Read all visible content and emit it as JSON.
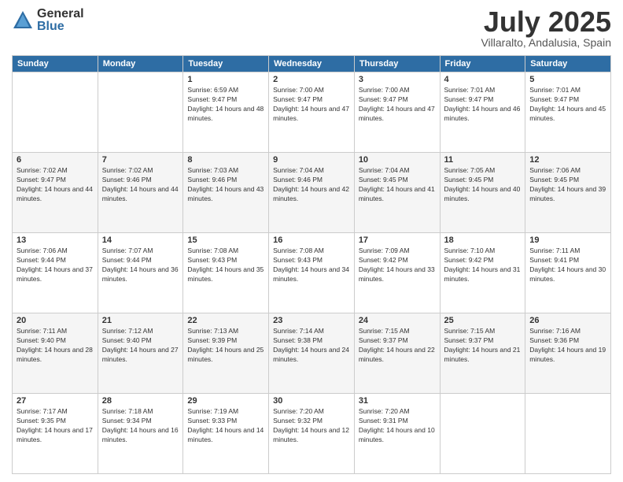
{
  "logo": {
    "general": "General",
    "blue": "Blue"
  },
  "title": "July 2025",
  "subtitle": "Villaralto, Andalusia, Spain",
  "days_header": [
    "Sunday",
    "Monday",
    "Tuesday",
    "Wednesday",
    "Thursday",
    "Friday",
    "Saturday"
  ],
  "weeks": [
    [
      {
        "day": "",
        "sunrise": "",
        "sunset": "",
        "daylight": ""
      },
      {
        "day": "",
        "sunrise": "",
        "sunset": "",
        "daylight": ""
      },
      {
        "day": "1",
        "sunrise": "Sunrise: 6:59 AM",
        "sunset": "Sunset: 9:47 PM",
        "daylight": "Daylight: 14 hours and 48 minutes."
      },
      {
        "day": "2",
        "sunrise": "Sunrise: 7:00 AM",
        "sunset": "Sunset: 9:47 PM",
        "daylight": "Daylight: 14 hours and 47 minutes."
      },
      {
        "day": "3",
        "sunrise": "Sunrise: 7:00 AM",
        "sunset": "Sunset: 9:47 PM",
        "daylight": "Daylight: 14 hours and 47 minutes."
      },
      {
        "day": "4",
        "sunrise": "Sunrise: 7:01 AM",
        "sunset": "Sunset: 9:47 PM",
        "daylight": "Daylight: 14 hours and 46 minutes."
      },
      {
        "day": "5",
        "sunrise": "Sunrise: 7:01 AM",
        "sunset": "Sunset: 9:47 PM",
        "daylight": "Daylight: 14 hours and 45 minutes."
      }
    ],
    [
      {
        "day": "6",
        "sunrise": "Sunrise: 7:02 AM",
        "sunset": "Sunset: 9:47 PM",
        "daylight": "Daylight: 14 hours and 44 minutes."
      },
      {
        "day": "7",
        "sunrise": "Sunrise: 7:02 AM",
        "sunset": "Sunset: 9:46 PM",
        "daylight": "Daylight: 14 hours and 44 minutes."
      },
      {
        "day": "8",
        "sunrise": "Sunrise: 7:03 AM",
        "sunset": "Sunset: 9:46 PM",
        "daylight": "Daylight: 14 hours and 43 minutes."
      },
      {
        "day": "9",
        "sunrise": "Sunrise: 7:04 AM",
        "sunset": "Sunset: 9:46 PM",
        "daylight": "Daylight: 14 hours and 42 minutes."
      },
      {
        "day": "10",
        "sunrise": "Sunrise: 7:04 AM",
        "sunset": "Sunset: 9:45 PM",
        "daylight": "Daylight: 14 hours and 41 minutes."
      },
      {
        "day": "11",
        "sunrise": "Sunrise: 7:05 AM",
        "sunset": "Sunset: 9:45 PM",
        "daylight": "Daylight: 14 hours and 40 minutes."
      },
      {
        "day": "12",
        "sunrise": "Sunrise: 7:06 AM",
        "sunset": "Sunset: 9:45 PM",
        "daylight": "Daylight: 14 hours and 39 minutes."
      }
    ],
    [
      {
        "day": "13",
        "sunrise": "Sunrise: 7:06 AM",
        "sunset": "Sunset: 9:44 PM",
        "daylight": "Daylight: 14 hours and 37 minutes."
      },
      {
        "day": "14",
        "sunrise": "Sunrise: 7:07 AM",
        "sunset": "Sunset: 9:44 PM",
        "daylight": "Daylight: 14 hours and 36 minutes."
      },
      {
        "day": "15",
        "sunrise": "Sunrise: 7:08 AM",
        "sunset": "Sunset: 9:43 PM",
        "daylight": "Daylight: 14 hours and 35 minutes."
      },
      {
        "day": "16",
        "sunrise": "Sunrise: 7:08 AM",
        "sunset": "Sunset: 9:43 PM",
        "daylight": "Daylight: 14 hours and 34 minutes."
      },
      {
        "day": "17",
        "sunrise": "Sunrise: 7:09 AM",
        "sunset": "Sunset: 9:42 PM",
        "daylight": "Daylight: 14 hours and 33 minutes."
      },
      {
        "day": "18",
        "sunrise": "Sunrise: 7:10 AM",
        "sunset": "Sunset: 9:42 PM",
        "daylight": "Daylight: 14 hours and 31 minutes."
      },
      {
        "day": "19",
        "sunrise": "Sunrise: 7:11 AM",
        "sunset": "Sunset: 9:41 PM",
        "daylight": "Daylight: 14 hours and 30 minutes."
      }
    ],
    [
      {
        "day": "20",
        "sunrise": "Sunrise: 7:11 AM",
        "sunset": "Sunset: 9:40 PM",
        "daylight": "Daylight: 14 hours and 28 minutes."
      },
      {
        "day": "21",
        "sunrise": "Sunrise: 7:12 AM",
        "sunset": "Sunset: 9:40 PM",
        "daylight": "Daylight: 14 hours and 27 minutes."
      },
      {
        "day": "22",
        "sunrise": "Sunrise: 7:13 AM",
        "sunset": "Sunset: 9:39 PM",
        "daylight": "Daylight: 14 hours and 25 minutes."
      },
      {
        "day": "23",
        "sunrise": "Sunrise: 7:14 AM",
        "sunset": "Sunset: 9:38 PM",
        "daylight": "Daylight: 14 hours and 24 minutes."
      },
      {
        "day": "24",
        "sunrise": "Sunrise: 7:15 AM",
        "sunset": "Sunset: 9:37 PM",
        "daylight": "Daylight: 14 hours and 22 minutes."
      },
      {
        "day": "25",
        "sunrise": "Sunrise: 7:15 AM",
        "sunset": "Sunset: 9:37 PM",
        "daylight": "Daylight: 14 hours and 21 minutes."
      },
      {
        "day": "26",
        "sunrise": "Sunrise: 7:16 AM",
        "sunset": "Sunset: 9:36 PM",
        "daylight": "Daylight: 14 hours and 19 minutes."
      }
    ],
    [
      {
        "day": "27",
        "sunrise": "Sunrise: 7:17 AM",
        "sunset": "Sunset: 9:35 PM",
        "daylight": "Daylight: 14 hours and 17 minutes."
      },
      {
        "day": "28",
        "sunrise": "Sunrise: 7:18 AM",
        "sunset": "Sunset: 9:34 PM",
        "daylight": "Daylight: 14 hours and 16 minutes."
      },
      {
        "day": "29",
        "sunrise": "Sunrise: 7:19 AM",
        "sunset": "Sunset: 9:33 PM",
        "daylight": "Daylight: 14 hours and 14 minutes."
      },
      {
        "day": "30",
        "sunrise": "Sunrise: 7:20 AM",
        "sunset": "Sunset: 9:32 PM",
        "daylight": "Daylight: 14 hours and 12 minutes."
      },
      {
        "day": "31",
        "sunrise": "Sunrise: 7:20 AM",
        "sunset": "Sunset: 9:31 PM",
        "daylight": "Daylight: 14 hours and 10 minutes."
      },
      {
        "day": "",
        "sunrise": "",
        "sunset": "",
        "daylight": ""
      },
      {
        "day": "",
        "sunrise": "",
        "sunset": "",
        "daylight": ""
      }
    ]
  ]
}
